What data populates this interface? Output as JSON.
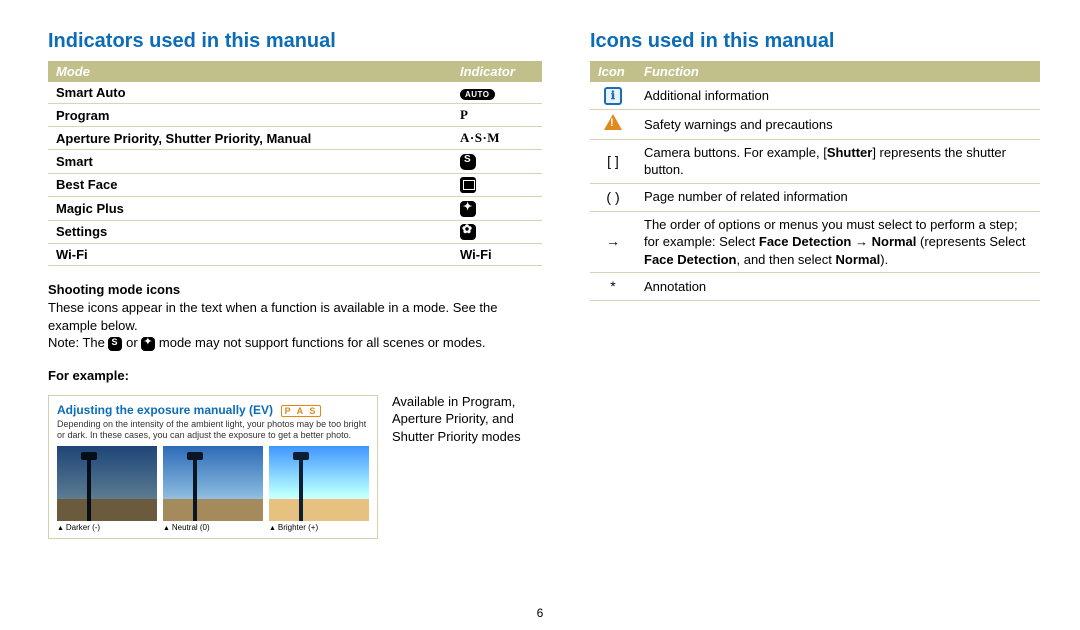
{
  "page_number": "6",
  "left": {
    "heading": "Indicators used in this manual",
    "table_headers": {
      "mode": "Mode",
      "indicator": "Indicator"
    },
    "rows": [
      {
        "mode": "Smart Auto",
        "ind": "AUTO",
        "kind": "auto"
      },
      {
        "mode": "Program",
        "ind": "P",
        "kind": "serif"
      },
      {
        "mode": "Aperture Priority, Shutter Priority, Manual",
        "ind": "A·S·M",
        "kind": "serif"
      },
      {
        "mode": "Smart",
        "ind": "",
        "kind": "s"
      },
      {
        "mode": "Best Face",
        "ind": "",
        "kind": "face"
      },
      {
        "mode": "Magic Plus",
        "ind": "",
        "kind": "plus"
      },
      {
        "mode": "Settings",
        "ind": "",
        "kind": "gear"
      },
      {
        "mode": "Wi-Fi",
        "ind": "Wi-Fi",
        "kind": "text"
      }
    ],
    "shoot_heading": "Shooting mode icons",
    "shoot_p1": "These icons appear in the text when a function is available in a mode. See the example below.",
    "shoot_note_pre": "Note: The ",
    "shoot_note_mid": " or ",
    "shoot_note_post": " mode may not support functions for all scenes or modes.",
    "for_example": "For example:",
    "ex_title": "Adjusting the exposure manually (EV)",
    "ex_badge": "P A S",
    "ex_sub": "Depending on the intensity of the ambient light, your photos may be too bright or dark. In these cases, you can adjust the exposure to get a better photo.",
    "thumb_caps": [
      "Darker (-)",
      "Neutral (0)",
      "Brighter (+)"
    ],
    "ex_note": "Available in Program, Aperture Priority, and Shutter Priority modes"
  },
  "right": {
    "heading": "Icons used in this manual",
    "table_headers": {
      "icon": "Icon",
      "func": "Function"
    },
    "rows": [
      {
        "icon": "info",
        "func_plain": "Additional information"
      },
      {
        "icon": "warn",
        "func_plain": "Safety warnings and precautions"
      },
      {
        "icon": "[  ]",
        "func_html": "Camera buttons. For example, [<b>Shutter</b>] represents the shutter button."
      },
      {
        "icon": "(  )",
        "func_plain": "Page number of related information"
      },
      {
        "icon": "→",
        "func_html": "The order of options or menus you must select to perform a step; for example: Select <b>Face Detection</b> → <b>Normal</b> (represents Select <b>Face Detection</b>, and then select <b>Normal</b>)."
      },
      {
        "icon": "*",
        "func_plain": "Annotation"
      }
    ]
  }
}
